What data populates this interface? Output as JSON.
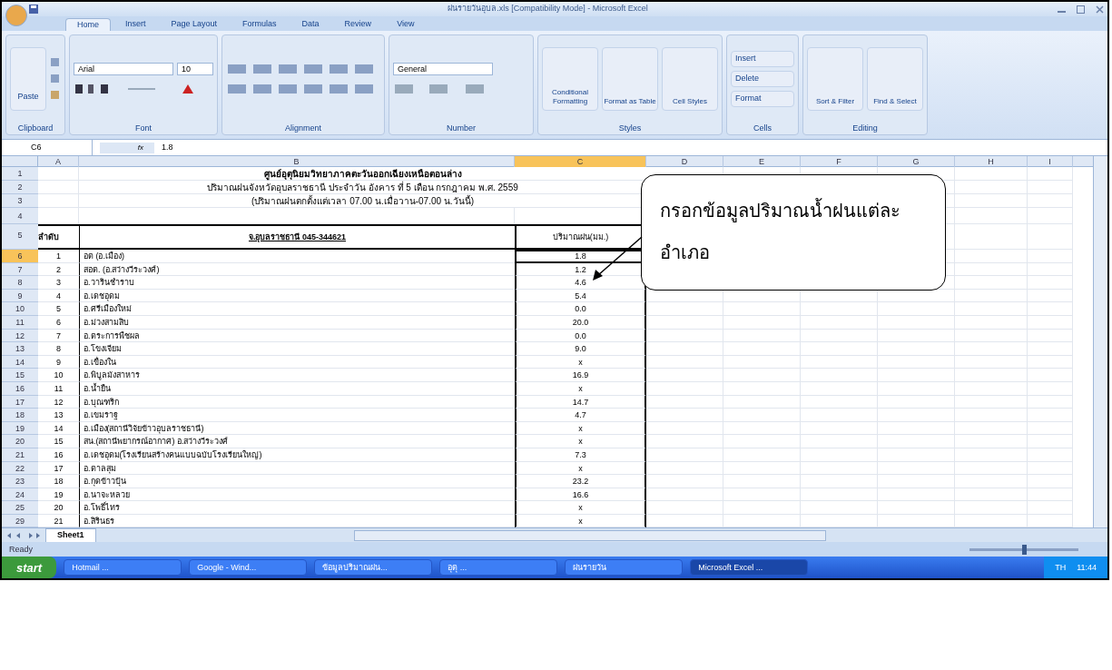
{
  "window": {
    "title": "ฝนรายวันอุบล.xls [Compatibility Mode] - Microsoft Excel"
  },
  "ribbon_tabs": [
    {
      "label": "Home",
      "selected": true
    },
    {
      "label": "Insert",
      "selected": false
    },
    {
      "label": "Page Layout",
      "selected": false
    },
    {
      "label": "Formulas",
      "selected": false
    },
    {
      "label": "Data",
      "selected": false
    },
    {
      "label": "Review",
      "selected": false
    },
    {
      "label": "View",
      "selected": false
    }
  ],
  "ribbon_groups": [
    {
      "label": "Clipboard",
      "kind": "clipboard",
      "buttons": [
        "Paste"
      ]
    },
    {
      "label": "Font",
      "kind": "font",
      "fields": [
        "Arial",
        "10"
      ]
    },
    {
      "label": "Alignment",
      "kind": "alignment"
    },
    {
      "label": "Number",
      "kind": "number",
      "fields": [
        "General"
      ]
    },
    {
      "label": "Styles",
      "kind": "large",
      "buttons": [
        "Conditional Formatting",
        "Format as Table",
        "Cell Styles"
      ]
    },
    {
      "label": "Cells",
      "kind": "small",
      "buttons": [
        "Insert",
        "Delete",
        "Format"
      ]
    },
    {
      "label": "Editing",
      "kind": "large",
      "buttons": [
        "Sort & Filter",
        "Find & Select"
      ]
    }
  ],
  "name_box": "C6",
  "function_label": "fx",
  "formula": "1.8",
  "columns": [
    {
      "label": "A",
      "selected": false
    },
    {
      "label": "B",
      "selected": false
    },
    {
      "label": "C",
      "selected": true
    },
    {
      "label": "D",
      "selected": false
    },
    {
      "label": "E",
      "selected": false
    },
    {
      "label": "F",
      "selected": false
    },
    {
      "label": "G",
      "selected": false
    },
    {
      "label": "H",
      "selected": false
    },
    {
      "label": "I",
      "selected": false
    }
  ],
  "title_lines": [
    "ศูนย์อุตุนิยมวิทยาภาคตะวันออกเฉียงเหนือตอนล่าง",
    "ปริมาณฝนจังหวัดอุบลราชธานี ประจำวัน อังคาร ที่ 5 เดือน กรกฎาคม พ.ศ. 2559",
    "(ปริมาณฝนตกตั้งแต่เวลา 07.00 น.เมื่อวาน-07.00 น.วันนี้)"
  ],
  "header": [
    "ลำดับ",
    "จ.อุบลราชธานี 045-344621",
    "ปริมาณฝน(มม.)"
  ],
  "row_headers": [
    {
      "label": "1",
      "selected": false
    },
    {
      "label": "2",
      "selected": false
    },
    {
      "label": "3",
      "selected": false
    },
    {
      "label": "4",
      "selected": false
    },
    {
      "label": "5",
      "selected": false
    },
    {
      "label": "6",
      "selected": true
    },
    {
      "label": "7",
      "selected": false
    },
    {
      "label": "8",
      "selected": false
    },
    {
      "label": "9",
      "selected": false
    },
    {
      "label": "10",
      "selected": false
    },
    {
      "label": "11",
      "selected": false
    },
    {
      "label": "12",
      "selected": false
    },
    {
      "label": "13",
      "selected": false
    },
    {
      "label": "14",
      "selected": false
    },
    {
      "label": "15",
      "selected": false
    },
    {
      "label": "16",
      "selected": false
    },
    {
      "label": "17",
      "selected": false
    },
    {
      "label": "18",
      "selected": false
    },
    {
      "label": "19",
      "selected": false
    },
    {
      "label": "20",
      "selected": false
    },
    {
      "label": "21",
      "selected": false
    },
    {
      "label": "22",
      "selected": false
    },
    {
      "label": "23",
      "selected": false
    },
    {
      "label": "24",
      "selected": false
    },
    {
      "label": "25",
      "selected": false
    },
    {
      "label": "29",
      "selected": false
    }
  ],
  "rows": [
    {
      "no": "1",
      "station": "อต (อ.เมือง)",
      "rain": "1.8"
    },
    {
      "no": "2",
      "station": "สอต. (อ.สว่างวีระวงศ์)",
      "rain": "1.2"
    },
    {
      "no": "3",
      "station": "อ.วารินชำราบ",
      "rain": "4.6"
    },
    {
      "no": "4",
      "station": "อ.เดชอุดม",
      "rain": "5.4"
    },
    {
      "no": "5",
      "station": "อ.ศรีเมืองใหม่",
      "rain": "0.0"
    },
    {
      "no": "6",
      "station": "อ.ม่วงสามสิบ",
      "rain": "20.0"
    },
    {
      "no": "7",
      "station": "อ.ตระการพืชผล",
      "rain": "0.0"
    },
    {
      "no": "8",
      "station": "อ.โขงเจียม",
      "rain": "9.0"
    },
    {
      "no": "9",
      "station": "อ.เขื่องใน",
      "rain": "x"
    },
    {
      "no": "10",
      "station": "อ.พิบูลมังสาหาร",
      "rain": "16.9"
    },
    {
      "no": "11",
      "station": "อ.น้ำยืน",
      "rain": "x"
    },
    {
      "no": "12",
      "station": "อ.บุณฑริก",
      "rain": "14.7"
    },
    {
      "no": "13",
      "station": "อ.เขมราฐ",
      "rain": "4.7"
    },
    {
      "no": "14",
      "station": "อ.เมือง(สถานีวิจัยข้าวอุบลราชธานี)",
      "rain": "x"
    },
    {
      "no": "15",
      "station": "สน.(สถานีพยากรณ์อากาศ) อ.สว่างวีระวงศ์",
      "rain": "x"
    },
    {
      "no": "16",
      "station": "อ.เดชอุดม(โรงเรียนสร้างคนแบบฉบับโรงเรียนใหญ่)",
      "rain": "7.3"
    },
    {
      "no": "17",
      "station": "อ.ตาลสุม",
      "rain": "x"
    },
    {
      "no": "18",
      "station": "อ.กุดข้าวปุ้น",
      "rain": "23.2"
    },
    {
      "no": "19",
      "station": "อ.นาจะหลวย",
      "rain": "16.6"
    },
    {
      "no": "20",
      "station": "อ.โพธิ์ไทร",
      "rain": "x"
    },
    {
      "no": "21",
      "station": "อ.สิรินธร",
      "rain": "x"
    }
  ],
  "sheet_tabs": [
    {
      "label": "Sheet1",
      "selected": true
    }
  ],
  "status_bar": {
    "text": "Ready"
  },
  "zoom": {
    "level": 0.5
  },
  "taskbar": {
    "start": "start",
    "items": [
      {
        "label": "Hotmail ...",
        "selected": false
      },
      {
        "label": "Google - Wind...",
        "selected": false
      },
      {
        "label": "ข้อมูลปริมาณฝน...",
        "selected": false
      },
      {
        "label": "อุตุ ...",
        "selected": false
      },
      {
        "label": "ฝนรายวัน",
        "selected": false
      },
      {
        "label": "Microsoft Excel ...",
        "selected": true
      }
    ],
    "language": "TH",
    "clock": "11:44"
  },
  "callout": {
    "text": "กรอกข้อมูลปริมาณน้ำฝนแต่ละอำเภอ"
  }
}
